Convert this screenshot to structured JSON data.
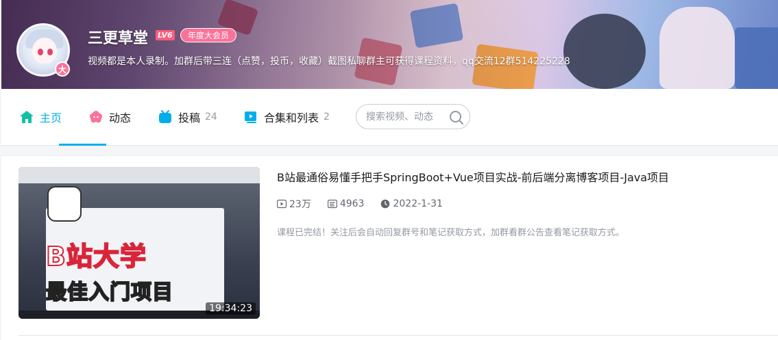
{
  "profile": {
    "username": "三更草堂",
    "level": "LV6",
    "vip_badge": "年度大会员",
    "avatar_badge": "大",
    "signature": "视频都是本人录制。加群后带三连（点赞，投币，收藏）截图私聊群主可获得课程资料，qq交流12群514225228"
  },
  "nav": {
    "home": {
      "label": "主页",
      "icon": "home-icon"
    },
    "dynamic": {
      "label": "动态",
      "icon": "dynamic-icon"
    },
    "uploads": {
      "label": "投稿",
      "count": "24",
      "icon": "tv-icon"
    },
    "collections": {
      "label": "合集和列表",
      "count": "2",
      "icon": "playlist-icon"
    }
  },
  "search": {
    "placeholder": "搜索视频、动态",
    "icon": "search-icon"
  },
  "video": {
    "title": "B站最通俗易懂手把手SpringBoot+Vue项目实战-前后端分离博客项目-Java项目",
    "views": "23万",
    "danmaku": "4963",
    "date": "2022-1-31",
    "description": "课程已完结！关注后会自动回复群号和笔记获取方式，加群看群公告查看笔记获取方式。",
    "duration": "19:34:23",
    "thumb_text_main": "B站大学",
    "thumb_text_sub": "最佳入门项目"
  },
  "colors": {
    "accent": "#00aeec",
    "pink": "#fb7299",
    "text": "#18191c",
    "muted": "#9499a0"
  }
}
